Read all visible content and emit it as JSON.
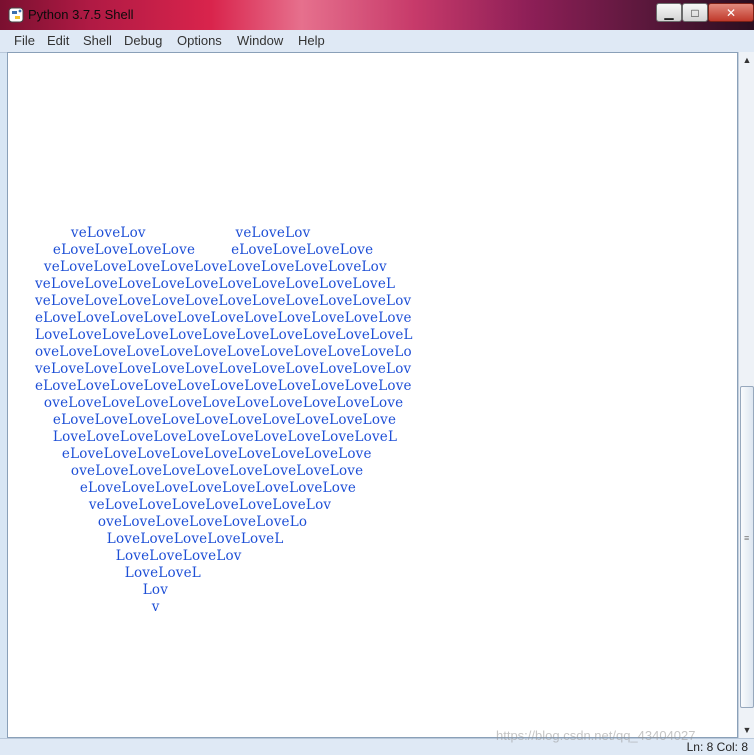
{
  "window": {
    "title": "Python 3.7.5 Shell",
    "controls": {
      "minimize": "▁",
      "maximize": "□",
      "close": "✕"
    }
  },
  "menubar": {
    "items": [
      "File",
      "Edit",
      "Shell",
      "Debug",
      "Options",
      "Window",
      "Help"
    ]
  },
  "shell": {
    "text_color": "#1e4fd6",
    "lines": [
      "              veLoveLov                    veLoveLov",
      "          eLoveLoveLoveLove        eLoveLoveLoveLove",
      "        veLoveLoveLoveLoveLoveLoveLoveLoveLoveLov",
      "      veLoveLoveLoveLoveLoveLoveLoveLoveLoveLoveL",
      "      veLoveLoveLoveLoveLoveLoveLoveLoveLoveLoveLov",
      "      eLoveLoveLoveLoveLoveLoveLoveLoveLoveLoveLove",
      "      LoveLoveLoveLoveLoveLoveLoveLoveLoveLoveLoveL",
      "      oveLoveLoveLoveLoveLoveLoveLoveLoveLoveLoveLo",
      "      veLoveLoveLoveLoveLoveLoveLoveLoveLoveLoveLov",
      "      eLoveLoveLoveLoveLoveLoveLoveLoveLoveLoveLove",
      "        oveLoveLoveLoveLoveLoveLoveLoveLoveLoveLove",
      "          eLoveLoveLoveLoveLoveLoveLoveLoveLoveLove",
      "          LoveLoveLoveLoveLoveLoveLoveLoveLoveLoveL",
      "            eLoveLoveLoveLoveLoveLoveLoveLoveLove",
      "              oveLoveLoveLoveLoveLoveLoveLoveLove",
      "                eLoveLoveLoveLoveLoveLoveLoveLove",
      "                  veLoveLoveLoveLoveLoveLoveLov",
      "                    oveLoveLoveLoveLoveLoveLo",
      "                      LoveLoveLoveLoveLoveL",
      "                        LoveLoveLoveLov",
      "                          LoveLoveL",
      "                              Lov",
      "                                v"
    ]
  },
  "statusbar": {
    "position": "Ln: 8   Col: 8",
    "watermark": "https://blog.csdn.net/qq_43404027"
  }
}
